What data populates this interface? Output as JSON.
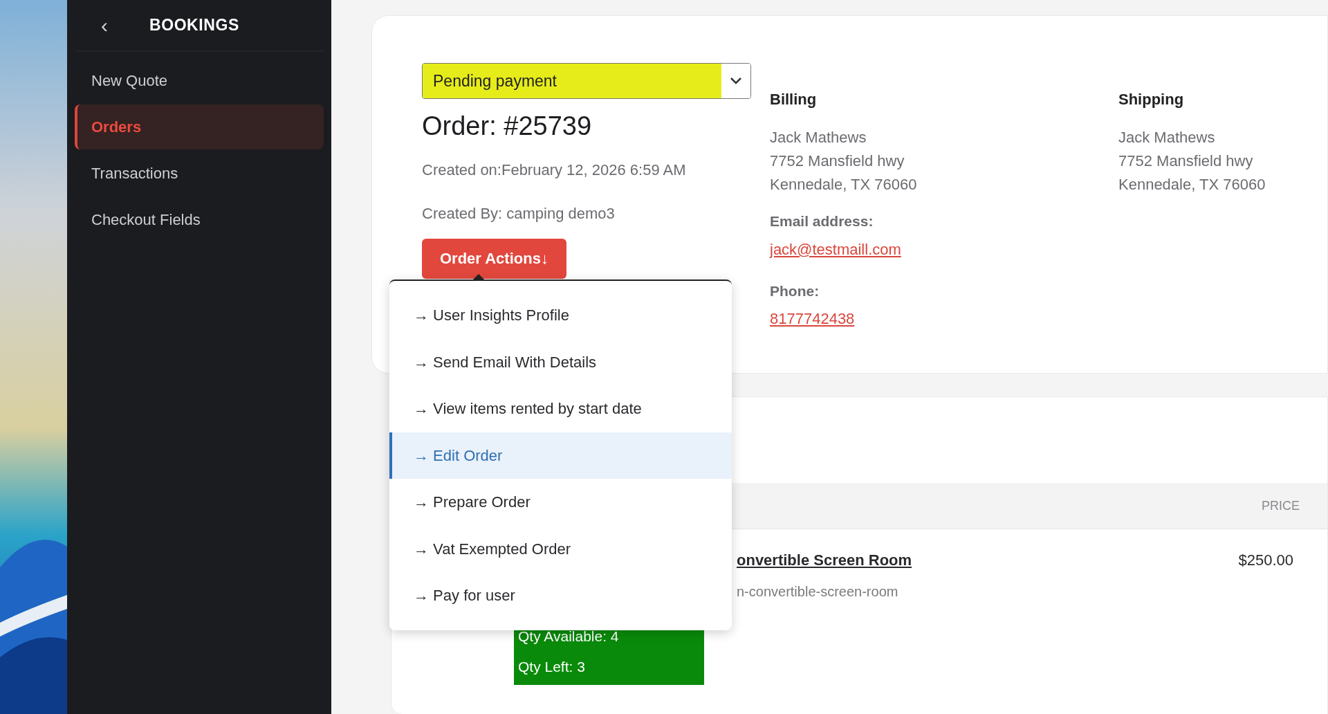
{
  "sidebar": {
    "title": "BOOKINGS",
    "back_icon": "‹",
    "items": [
      {
        "label": "New Quote",
        "selected": false
      },
      {
        "label": "Orders",
        "selected": true
      },
      {
        "label": "Transactions",
        "selected": false
      },
      {
        "label": "Checkout Fields",
        "selected": false
      }
    ]
  },
  "order": {
    "status": "Pending payment",
    "title": "Order: #25739",
    "created_on": "Created on:February 12, 2026 6:59 AM",
    "created_by": "Created By: camping demo3",
    "actions_button": "Order Actions↓"
  },
  "billing": {
    "heading": "Billing",
    "address": [
      "Jack Mathews",
      "7752 Mansfield hwy",
      "Kennedale, TX 76060"
    ],
    "email_label": "Email address:",
    "email": "jack@testmaill.com",
    "phone_label": "Phone:",
    "phone": "8177742438"
  },
  "shipping": {
    "heading": "Shipping",
    "address": [
      "Jack Mathews",
      "7752 Mansfield hwy",
      "Kennedale, TX 76060"
    ]
  },
  "actions_menu": [
    {
      "label": "→ User Insights Profile",
      "selected": false
    },
    {
      "label": "→ Send Email With Details",
      "selected": false
    },
    {
      "label": "→ View items rented by start date",
      "selected": false
    },
    {
      "label": "→ Edit Order",
      "selected": true
    },
    {
      "label": "→ Prepare Order",
      "selected": false
    },
    {
      "label": "→ Vat Exempted Order",
      "selected": false
    },
    {
      "label": "→ Pay for user",
      "selected": false
    }
  ],
  "items_table": {
    "columns": [
      "PRICE"
    ],
    "rows": [
      {
        "name": "onvertible Screen Room",
        "slug": "n-convertible-screen-room",
        "price": "$250.00",
        "stock": [
          "Qty Available: 4",
          "Qty Left: 3"
        ]
      }
    ]
  }
}
